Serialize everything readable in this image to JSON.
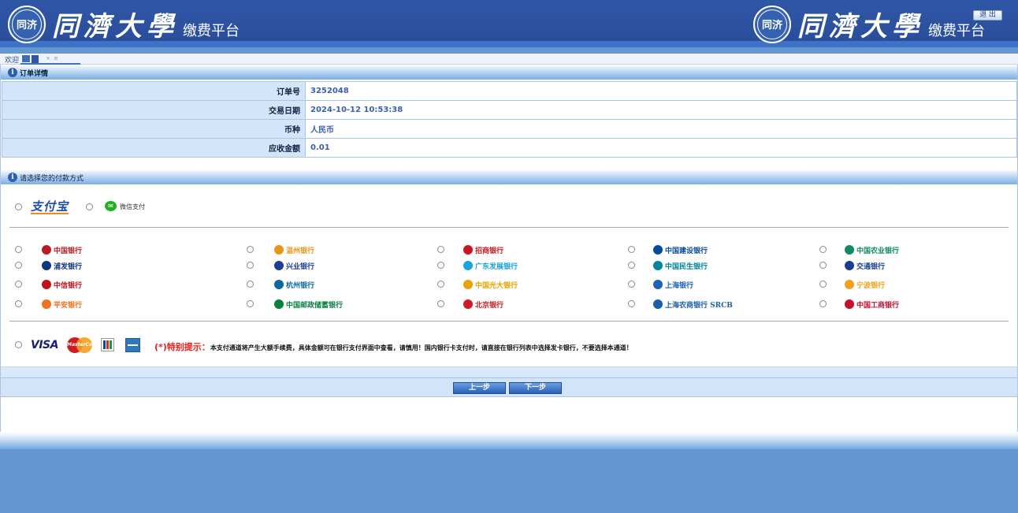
{
  "header": {
    "seal_text": "同济",
    "brand_name": "同濟大學",
    "brand_sub": "缴费平台",
    "logout_label": "退 出"
  },
  "tabbar": {
    "tab_label": "欢迎",
    "dots": "× ≡"
  },
  "order": {
    "section_title": "订单详情",
    "rows": [
      {
        "label": "订单号",
        "value": "3252048"
      },
      {
        "label": "交易日期",
        "value": "2024-10-12 10:53:38"
      },
      {
        "label": "币种",
        "value": "人民币"
      },
      {
        "label": "应收金额",
        "value": "0.01"
      }
    ]
  },
  "payment": {
    "section_title": "请选择您的付款方式",
    "alipay_label": "支付宝",
    "wechat_label": "微信支付",
    "banks": [
      [
        {
          "name": "中国银行",
          "color": "#b81c22"
        },
        {
          "name": "温州银行",
          "color": "#e8961b"
        },
        {
          "name": "招商银行",
          "color": "#c8171e"
        },
        {
          "name": "中国建设银行",
          "color": "#0a4a9c"
        },
        {
          "name": "中国农业银行",
          "color": "#0f8a64"
        }
      ],
      [
        {
          "name": "浦发银行",
          "color": "#12357f"
        },
        {
          "name": "兴业银行",
          "color": "#1c3f94"
        },
        {
          "name": "广东发展银行",
          "color": "#1aa3dd"
        },
        {
          "name": "中国民生银行",
          "color": "#00859a"
        },
        {
          "name": "交通银行",
          "color": "#1b3f8e"
        }
      ],
      [
        {
          "name": "中信银行",
          "color": "#c1121c"
        },
        {
          "name": "杭州银行",
          "color": "#0b6a9d"
        },
        {
          "name": "中国光大银行",
          "color": "#e6a400"
        },
        {
          "name": "上海银行",
          "color": "#1e63b5"
        },
        {
          "name": "宁波银行",
          "color": "#f0a01a"
        }
      ],
      [
        {
          "name": "平安银行",
          "color": "#f36f21"
        },
        {
          "name": "中国邮政储蓄银行",
          "color": "#0a7f3f"
        },
        {
          "name": "北京银行",
          "color": "#cf1b24"
        },
        {
          "name": "上海农商银行 SRCB",
          "color": "#1d5ea8"
        },
        {
          "name": "中国工商银行",
          "color": "#c8102e"
        }
      ]
    ],
    "cards": {
      "visa": "VISA",
      "mastercard": "MasterCard"
    },
    "notice_label": "(*)特别提示：",
    "notice_text": "本支付通道将产生大额手续费，具体金额可在银行支付界面中查看，请慎用！国内银行卡支付时，请直接在银行列表中选择发卡银行，不要选择本通道！"
  },
  "buttons": {
    "prev_label": "上一步",
    "next_label": "下一步"
  }
}
